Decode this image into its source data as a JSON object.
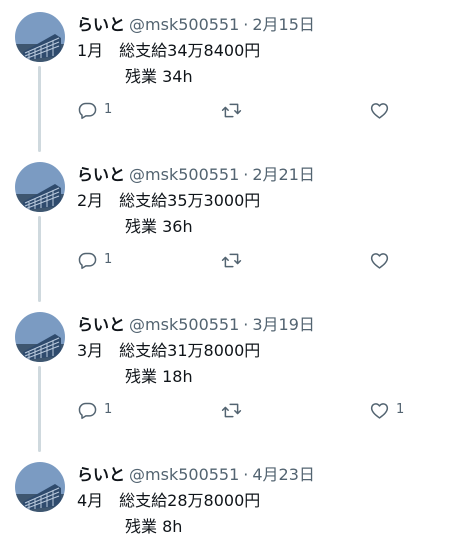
{
  "tweets": [
    {
      "author": "らいと",
      "handle": "@msk500551",
      "separator": "·",
      "date": "2月15日",
      "line1": "1月　総支給34万8400円",
      "line2": "　　　残業 34h",
      "reply_count": "1",
      "retweet_count": "",
      "like_count": ""
    },
    {
      "author": "らいと",
      "handle": "@msk500551",
      "separator": "·",
      "date": "2月21日",
      "line1": "2月　総支給35万3000円",
      "line2": "　　　残業 36h",
      "reply_count": "1",
      "retweet_count": "",
      "like_count": ""
    },
    {
      "author": "らいと",
      "handle": "@msk500551",
      "separator": "·",
      "date": "3月19日",
      "line1": "3月　総支給31万8000円",
      "line2": "　　　残業 18h",
      "reply_count": "1",
      "retweet_count": "",
      "like_count": "1"
    },
    {
      "author": "らいと",
      "handle": "@msk500551",
      "separator": "·",
      "date": "4月23日",
      "line1": "4月　総支給28万8000円",
      "line2": "　　　残業 8h",
      "reply_count": "",
      "retweet_count": "",
      "like_count": ""
    }
  ],
  "icons": {
    "reply": "reply-icon",
    "retweet": "retweet-icon",
    "like": "heart-icon"
  },
  "colors": {
    "text": "#0f1419",
    "secondary": "#536471",
    "thread_line": "#cfd9de"
  }
}
